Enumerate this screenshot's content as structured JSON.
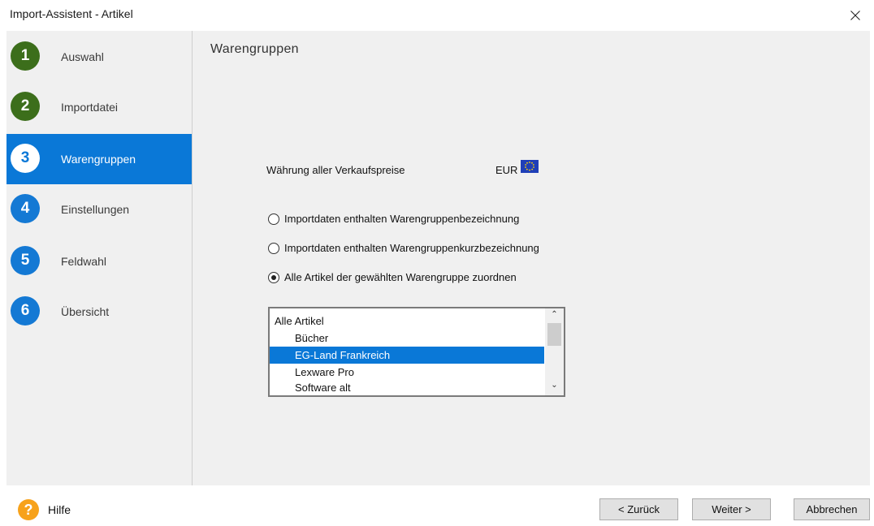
{
  "window": {
    "title": "Import-Assistent - Artikel"
  },
  "steps": [
    {
      "number": "1",
      "label": "Auswahl"
    },
    {
      "number": "2",
      "label": "Importdatei"
    },
    {
      "number": "3",
      "label": "Warengruppen"
    },
    {
      "number": "4",
      "label": "Einstellungen"
    },
    {
      "number": "5",
      "label": "Feldwahl"
    },
    {
      "number": "6",
      "label": "Übersicht"
    }
  ],
  "main": {
    "heading": "Warengruppen",
    "currency_label": "Währung aller Verkaufspreise",
    "currency_code": "EUR",
    "radio_options": [
      {
        "label": "Importdaten enthalten Warengruppenbezeichnung",
        "selected": false
      },
      {
        "label": "Importdaten enthalten Warengruppenkurzbezeichnung",
        "selected": false
      },
      {
        "label": "Alle Artikel der gewählten Warengruppe zuordnen",
        "selected": true
      }
    ],
    "groups_list": {
      "items": [
        "Alle Artikel",
        "Bücher",
        "EG-Land Frankreich",
        "Lexware Pro",
        "Software alt"
      ],
      "selected": "EG-Land Frankreich"
    }
  },
  "footer": {
    "help_icon_glyph": "?",
    "help_label": "Hilfe",
    "back_label": "< Zurück",
    "next_label": "Weiter >",
    "cancel_label": "Abbrechen"
  },
  "colors": {
    "accent": "#0a78d7",
    "step_done": "#3c6e1b",
    "step_todo": "#1479d4",
    "help": "#f7a21b"
  }
}
